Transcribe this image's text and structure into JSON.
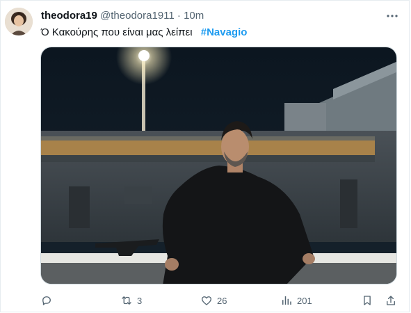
{
  "tweet": {
    "display_name": "theodora19",
    "handle": "@theodora1911",
    "separator": "·",
    "time": "10m",
    "text": "Ό Κακούρης που είναι μας λείπει",
    "hashtag": "#Navagio",
    "more_icon": "more-dots-icon"
  },
  "actions": {
    "reply": {
      "icon": "reply-icon",
      "count": ""
    },
    "retweet": {
      "icon": "retweet-icon",
      "count": "3"
    },
    "like": {
      "icon": "heart-icon",
      "count": "26"
    },
    "views": {
      "icon": "analytics-icon",
      "count": "201"
    },
    "bookmark": {
      "icon": "bookmark-icon"
    },
    "share": {
      "icon": "share-icon"
    }
  },
  "colors": {
    "accent": "#1d9bf0",
    "muted": "#536471",
    "text": "#0f1419"
  }
}
